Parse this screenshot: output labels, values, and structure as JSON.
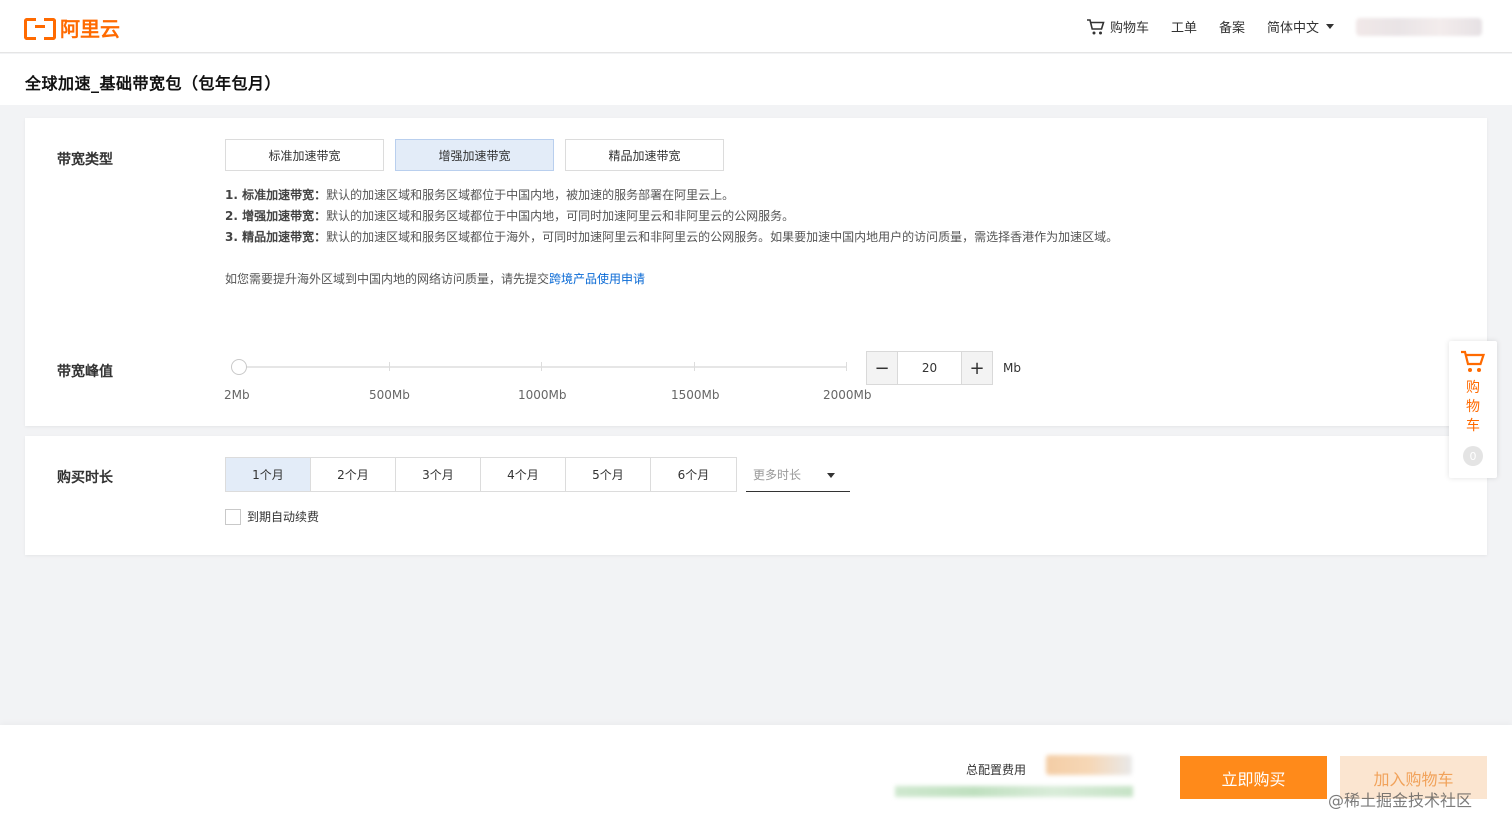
{
  "header": {
    "logo_text": "阿里云",
    "nav": {
      "cart": "购物车",
      "ticket": "工单",
      "filing": "备案",
      "language": "简体中文"
    }
  },
  "page": {
    "title": "全球加速_基础带宽包（包年包月）"
  },
  "bandwidth_type": {
    "label": "带宽类型",
    "options": [
      "标准加速带宽",
      "增强加速带宽",
      "精品加速带宽"
    ],
    "selected": "增强加速带宽",
    "descriptions": [
      {
        "term": "1. 标准加速带宽：",
        "text": "默认的加速区域和服务区域都位于中国内地，被加速的服务部署在阿里云上。"
      },
      {
        "term": "2. 增强加速带宽：",
        "text": "默认的加速区域和服务区域都位于中国内地，可同时加速阿里云和非阿里云的公网服务。"
      },
      {
        "term": "3. 精品加速带宽：",
        "text": "默认的加速区域和服务区域都位于海外，可同时加速阿里云和非阿里云的公网服务。如果要加速中国内地用户的访问质量，需选择香港作为加速区域。"
      }
    ],
    "note_prefix": "如您需要提升海外区域到中国内地的网络访问质量，请先提交",
    "note_link": "跨境产品使用申请"
  },
  "bandwidth_peak": {
    "label": "带宽峰值",
    "slider_labels": [
      "2Mb",
      "500Mb",
      "1000Mb",
      "1500Mb",
      "2000Mb"
    ],
    "value": "20",
    "unit": "Mb",
    "minus": "−",
    "plus": "+"
  },
  "duration": {
    "label": "购买时长",
    "options": [
      "1个月",
      "2个月",
      "3个月",
      "4个月",
      "5个月",
      "6个月"
    ],
    "selected": "1个月",
    "more_placeholder": "更多时长",
    "auto_renew": "到期自动续费"
  },
  "float_cart": {
    "label": "购物车",
    "count": "0"
  },
  "footer": {
    "total_label": "总配置费用",
    "buy_now": "立即购买",
    "add_to_cart": "加入购物车",
    "watermark": "@稀土掘金技术社区"
  },
  "colors": {
    "brand": "#ff6a00",
    "link": "#0a6ad5",
    "selected_bg": "#e3ecf8",
    "buy_button": "#ff8a1a"
  }
}
